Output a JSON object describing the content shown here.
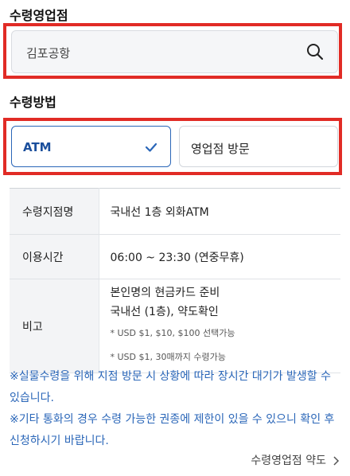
{
  "branch_section": {
    "title": "수령영업점",
    "value": "김포공항"
  },
  "method_section": {
    "title": "수령방법",
    "options": [
      {
        "label": "ATM",
        "selected": true
      },
      {
        "label": "영업점 방문",
        "selected": false
      }
    ]
  },
  "info_table": {
    "rows": [
      {
        "header": "수령지점명",
        "value": "국내선 1층 외화ATM"
      },
      {
        "header": "이용시간",
        "value": "06:00 ~ 23:30 (연중무휴)"
      },
      {
        "header": "비고",
        "lines": [
          "본인명의 현금카드 준비",
          "국내선 (1층), 약도확인"
        ],
        "small_lines": [
          "* USD $1, $10, $100 선택가능",
          "* USD $1, 30매까지 수령가능"
        ]
      }
    ]
  },
  "notices": [
    "※실물수령을 위해 지점 방문 시 상황에 따라 장시간 대기가 발생할 수 있습니다.",
    "※기타 통화의 경우 수령 가능한 권종에 제한이 있을 수 있으니 확인 후 신청하시기 바랍니다."
  ],
  "terms_link": "수령영업점 약도",
  "colors": {
    "accent": "#2a66b8",
    "highlight": "#e12b25"
  }
}
